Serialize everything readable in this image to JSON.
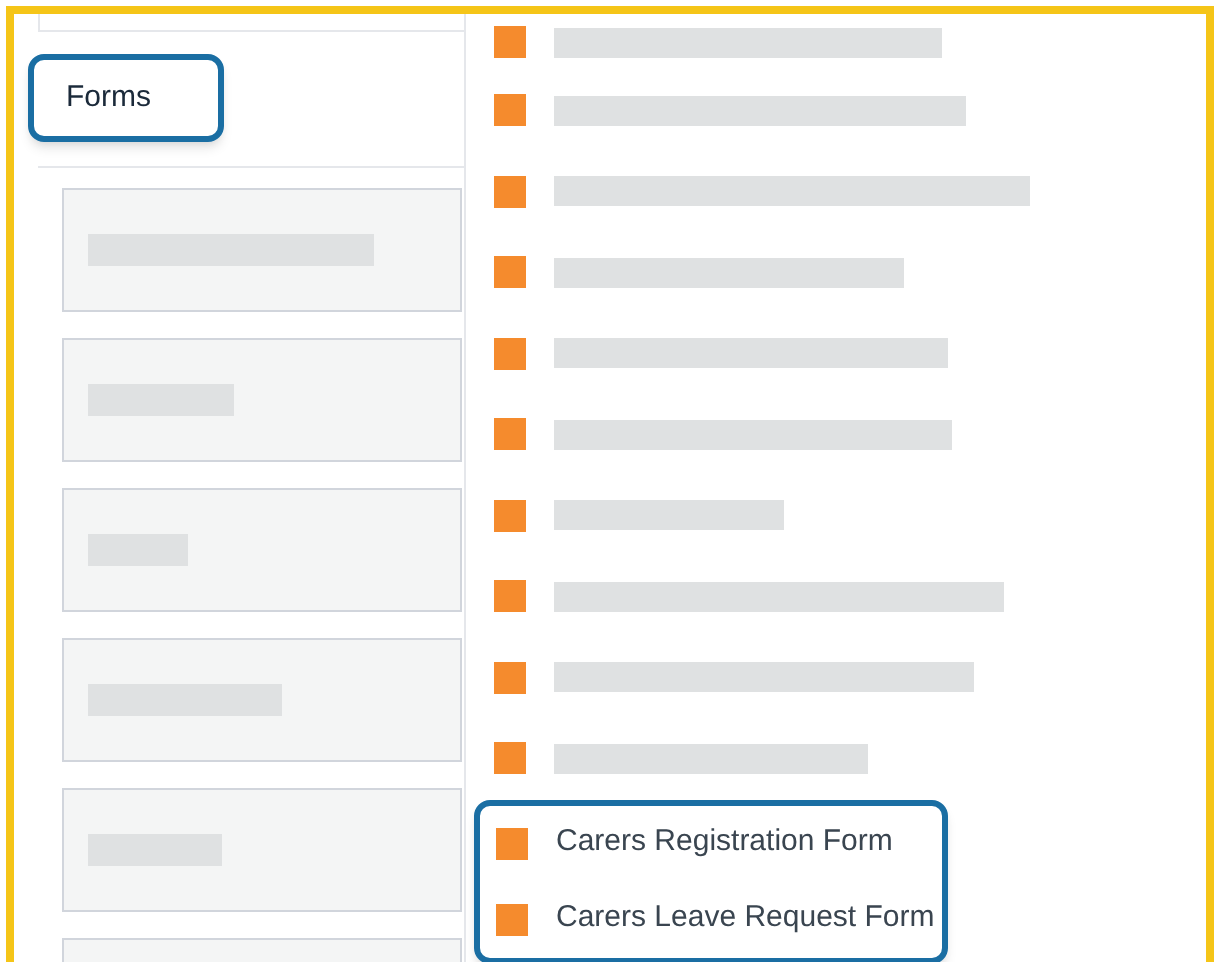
{
  "sidebar": {
    "tab": {
      "label": "Forms",
      "highlighted": true
    },
    "cards": [
      {
        "kind": "redacted"
      },
      {
        "kind": "redacted"
      },
      {
        "kind": "redacted"
      },
      {
        "kind": "redacted"
      },
      {
        "kind": "redacted"
      },
      {
        "kind": "blank"
      }
    ]
  },
  "list": [
    {
      "kind": "redacted"
    },
    {
      "kind": "redacted"
    },
    {
      "kind": "redacted"
    },
    {
      "kind": "redacted"
    },
    {
      "kind": "redacted"
    },
    {
      "kind": "redacted"
    },
    {
      "kind": "redacted"
    },
    {
      "kind": "redacted"
    },
    {
      "kind": "redacted"
    },
    {
      "kind": "redacted"
    },
    {
      "kind": "link",
      "label": "Carers Registration Form",
      "highlighted": true
    },
    {
      "kind": "link",
      "label": "Carers Leave Request Form",
      "highlighted": true
    }
  ]
}
